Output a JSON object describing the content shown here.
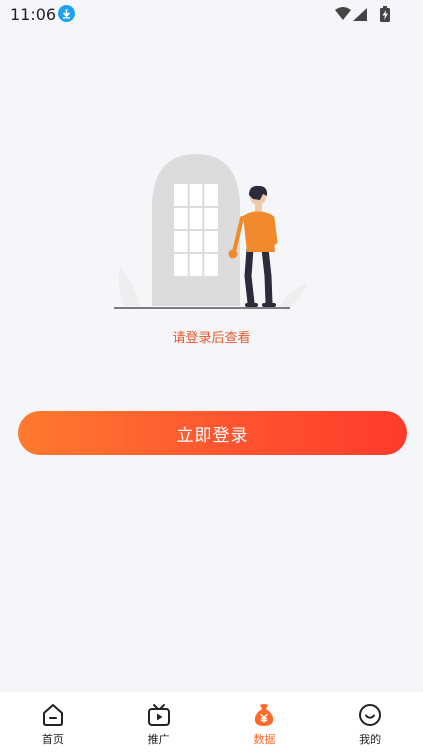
{
  "status_bar": {
    "time": "11:06",
    "icons": [
      "download-icon",
      "wifi-icon",
      "signal-icon",
      "battery-charging-icon"
    ]
  },
  "main": {
    "hint": "请登录后查看",
    "login_button": "立即登录"
  },
  "tab_bar": {
    "active_index": 2,
    "active_color": "#ff6a2a",
    "tabs": [
      {
        "label": "首页",
        "icon": "home-icon"
      },
      {
        "label": "推广",
        "icon": "tv-icon"
      },
      {
        "label": "数据",
        "icon": "money-bag-icon"
      },
      {
        "label": "我的",
        "icon": "smile-face-icon"
      }
    ]
  }
}
